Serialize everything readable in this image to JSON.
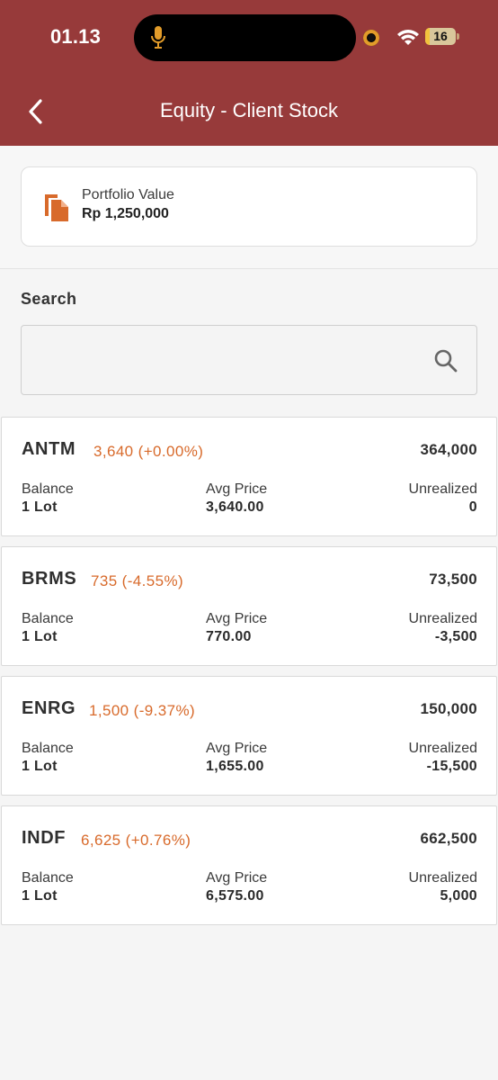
{
  "status_bar": {
    "time": "01.13",
    "battery": "16",
    "battery_level": 0.16
  },
  "nav": {
    "title": "Equity - Client Stock"
  },
  "portfolio": {
    "label": "Portfolio Value",
    "value": "Rp 1,250,000"
  },
  "search": {
    "label": "Search",
    "value": "",
    "placeholder": ""
  },
  "colors": {
    "header": "#973a3a",
    "accent_orange": "#d86a2b"
  },
  "labels": {
    "balance": "Balance",
    "avg_price": "Avg Price",
    "unrealized": "Unrealized"
  },
  "stocks": [
    {
      "code": "ANTM",
      "price": "3,640 (+0.00%)",
      "value": "364,000",
      "balance": "1 Lot",
      "avg_price": "3,640.00",
      "unrealized": "0"
    },
    {
      "code": "BRMS",
      "price": "735 (-4.55%)",
      "value": "73,500",
      "balance": "1 Lot",
      "avg_price": "770.00",
      "unrealized": "-3,500"
    },
    {
      "code": "ENRG",
      "price": "1,500 (-9.37%)",
      "value": "150,000",
      "balance": "1 Lot",
      "avg_price": "1,655.00",
      "unrealized": "-15,500"
    },
    {
      "code": "INDF",
      "price": "6,625 (+0.76%)",
      "value": "662,500",
      "balance": "1 Lot",
      "avg_price": "6,575.00",
      "unrealized": "5,000"
    }
  ]
}
